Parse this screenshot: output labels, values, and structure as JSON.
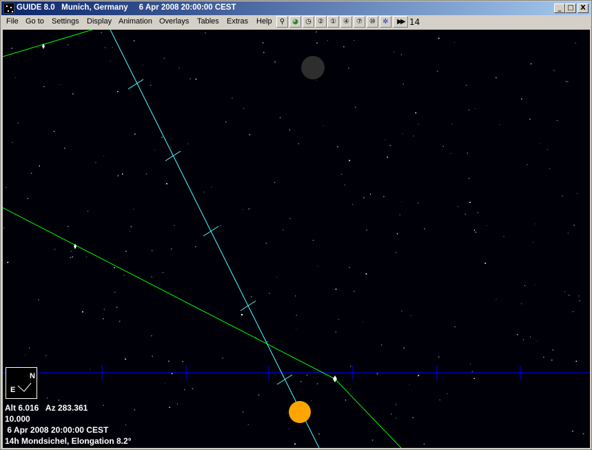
{
  "window": {
    "title": "GUIDE 8.0   Munich, Germany     6 Apr 2008 20:00:00 CEST",
    "minimize_label": "_",
    "maximize_label": "□",
    "close_label": "X"
  },
  "menu": {
    "items": [
      "File",
      "Go to",
      "Settings",
      "Display",
      "Animation",
      "Overlays",
      "Tables",
      "Extras",
      "Help"
    ]
  },
  "toolbar": {
    "icons": [
      "telescope-icon",
      "planet-icon",
      "clock-icon",
      "zoom-2-icon",
      "zoom-1-icon",
      "zoom-4-icon",
      "zoom-7-icon",
      "zoom-10-icon",
      "star-pattern-icon",
      "fast-forward-icon"
    ],
    "icon_glyphs": [
      "⚲",
      "◕",
      "◷",
      "②",
      "①",
      "④",
      "⑦",
      "⑩",
      "✲",
      "▶▶"
    ],
    "counter": "14"
  },
  "compass": {
    "north": "N",
    "east": "E"
  },
  "readout": {
    "alt_az": "Alt 6.016   Az 283.361",
    "field": "10.000",
    "datetime": " 6 Apr 2008 20:00:00 CEST",
    "object": "14h Mondsichel, Elongation 8.2°"
  },
  "colors": {
    "sky": "#000008",
    "horizon": "#0000ff",
    "ecliptic": "#00ff00",
    "moon_path": "#55ffff",
    "sun": "#ffa500",
    "moon": "#2e2e2e"
  }
}
